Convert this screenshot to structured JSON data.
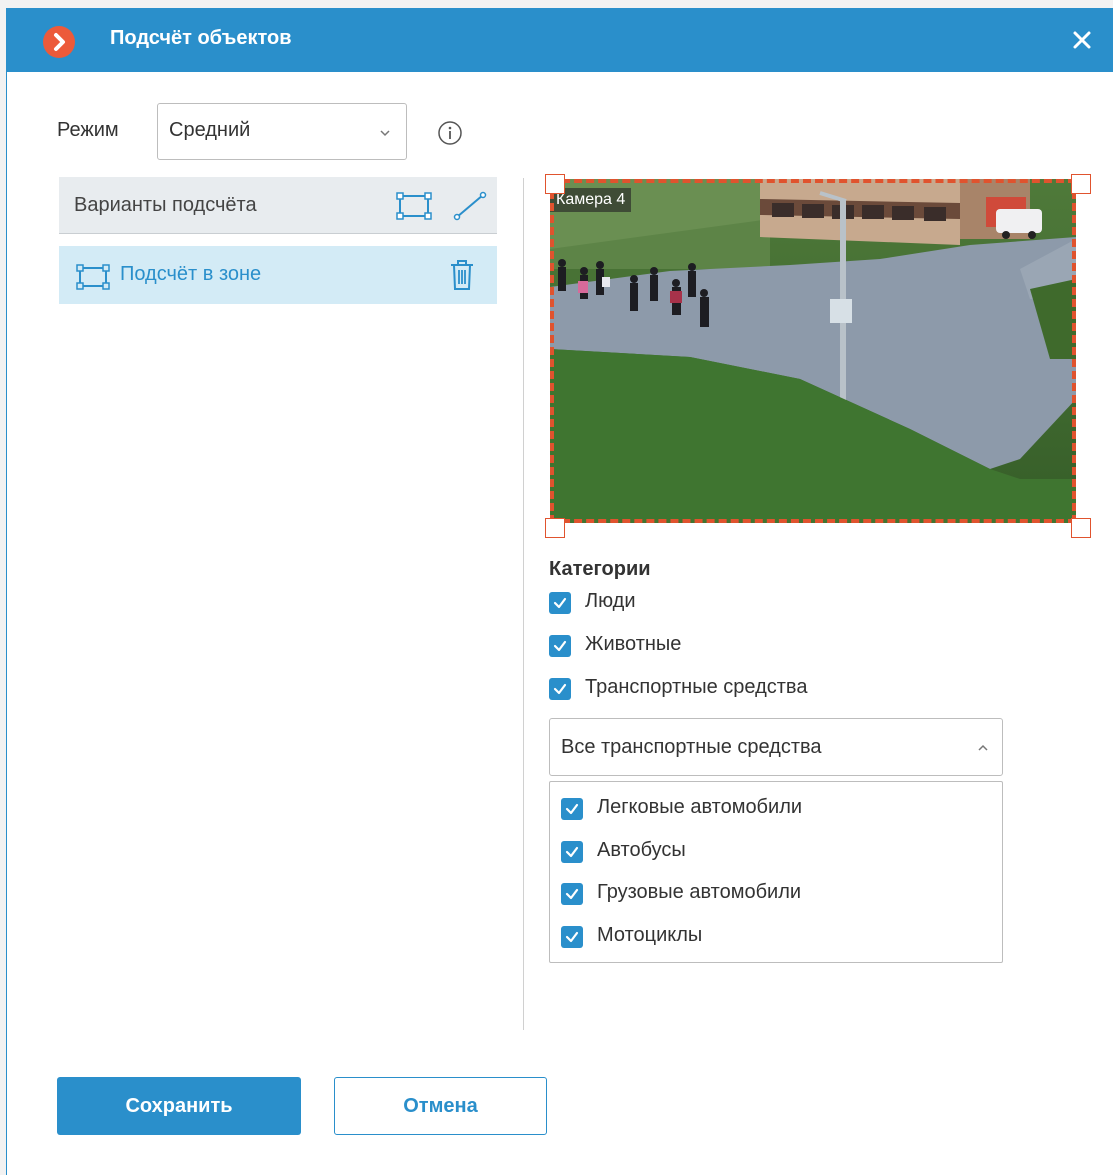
{
  "window": {
    "title": "Подсчёт объектов",
    "logo_icon": "arrow-right-circle-icon",
    "close_icon": "close-icon",
    "accent_color": "#2a8fcb"
  },
  "mode": {
    "label": "Режим",
    "selected": "Средний",
    "info_icon": "info-icon"
  },
  "variants": {
    "header_label": "Варианты подсчёта",
    "tools": [
      "zone-rectangle-icon",
      "line-icon"
    ],
    "items": [
      {
        "label": "Подсчёт в зоне",
        "icon": "zone-rectangle-icon",
        "delete_icon": "trash-icon",
        "selected": true
      }
    ]
  },
  "camera": {
    "label": "Камера 4",
    "zone_color": "#e0532e"
  },
  "categories": {
    "title": "Категории",
    "items": [
      {
        "label": "Люди",
        "checked": true
      },
      {
        "label": "Животные",
        "checked": true
      },
      {
        "label": "Транспортные средства",
        "checked": true
      }
    ]
  },
  "vehicles": {
    "selected": "Все транспортные средства",
    "expanded": true,
    "options": [
      {
        "label": "Легковые автомобили",
        "checked": true
      },
      {
        "label": "Автобусы",
        "checked": true
      },
      {
        "label": "Грузовые автомобили",
        "checked": true
      },
      {
        "label": "Мотоциклы",
        "checked": true
      }
    ]
  },
  "buttons": {
    "save": "Сохранить",
    "cancel": "Отмена"
  }
}
